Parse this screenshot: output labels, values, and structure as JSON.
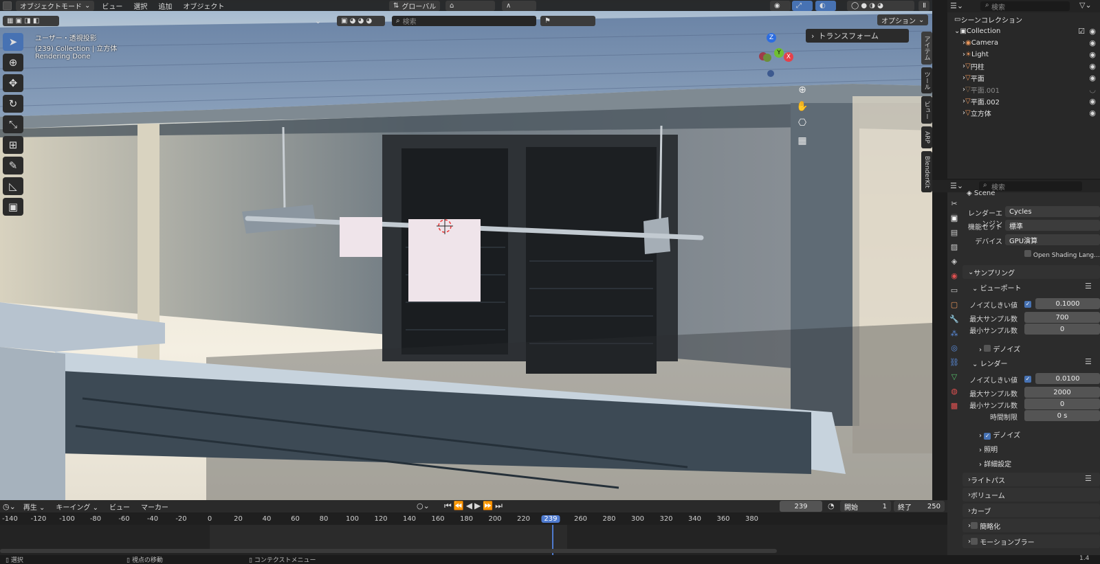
{
  "viewport": {
    "mode": "オブジェクトモード",
    "menus": [
      "ビュー",
      "選択",
      "追加",
      "オブジェクト"
    ],
    "orientation": "グローバル",
    "search_placeholder": "検索",
    "options": "オプション",
    "overlay_user": "ユーザー・透視投影",
    "overlay_collection": "(239) Collection | 立方体",
    "overlay_status": "Rendering Done",
    "transform_panel": "トランスフォーム",
    "side_tabs": [
      "アイテム",
      "ツール",
      "ビュー",
      "ARP",
      "BlenderKit"
    ],
    "gizmo": {
      "z": "Z",
      "y": "Y",
      "x": "X"
    }
  },
  "outliner": {
    "search_placeholder": "検索",
    "scene_collection": "シーンコレクション",
    "collection": "Collection",
    "items": [
      {
        "name": "Camera",
        "enabled": true
      },
      {
        "name": "Light",
        "enabled": true
      },
      {
        "name": "円柱",
        "enabled": true
      },
      {
        "name": "平面",
        "enabled": true
      },
      {
        "name": "平面.001",
        "enabled": false
      },
      {
        "name": "平面.002",
        "enabled": true
      },
      {
        "name": "立方体",
        "enabled": true
      }
    ]
  },
  "properties": {
    "search_placeholder": "検索",
    "scene": "Scene",
    "render_engine_label": "レンダーエンジン",
    "render_engine": "Cycles",
    "feature_set_label": "機能セット",
    "feature_set": "標準",
    "device_label": "デバイス",
    "device": "GPU演算",
    "osl": "Open Shading Lang...",
    "sampling": "サンプリング",
    "viewport": "ビューポート",
    "noise_threshold_label": "ノイズしきい値",
    "vp_noise": "0.1000",
    "max_samples_label": "最大サンプル数",
    "vp_max": "700",
    "min_samples_label": "最小サンプル数",
    "vp_min": "0",
    "denoise": "デノイズ",
    "render": "レンダー",
    "r_noise": "0.0100",
    "r_max": "2000",
    "r_min": "0",
    "time_limit_label": "時間制限",
    "time_limit": "0 s",
    "lighting": "照明",
    "advanced": "詳細設定",
    "light_paths": "ライトパス",
    "volumes": "ボリューム",
    "curves": "カーブ",
    "simplify": "簡略化",
    "motion_blur": "モーションブラー"
  },
  "timeline": {
    "menus": [
      "再生",
      "キーイング",
      "ビュー",
      "マーカー"
    ],
    "current_frame": "239",
    "start_label": "開始",
    "start": "1",
    "end_label": "終了",
    "end": "250",
    "ticks": [
      "-140",
      "-120",
      "-100",
      "-80",
      "-60",
      "-40",
      "-20",
      "0",
      "20",
      "40",
      "60",
      "80",
      "100",
      "120",
      "140",
      "160",
      "180",
      "200",
      "220",
      "239",
      "260",
      "280",
      "300",
      "320",
      "340",
      "360",
      "380"
    ]
  },
  "status": {
    "select": "選択",
    "pan": "視点の移動",
    "context": "コンテクストメニュー",
    "version": "1.4"
  }
}
